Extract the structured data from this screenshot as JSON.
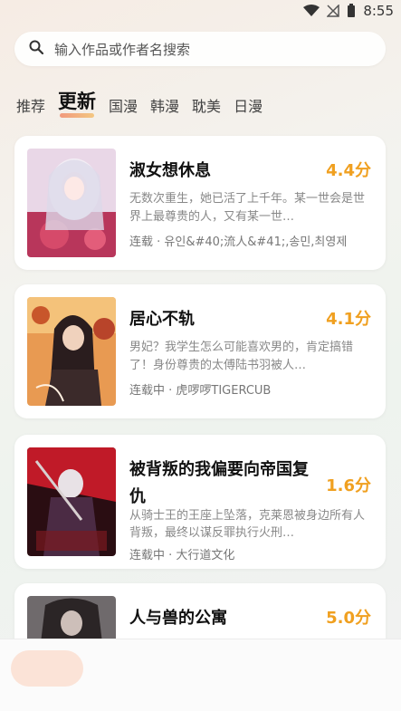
{
  "status": {
    "time": "8:55"
  },
  "search": {
    "placeholder": "输入作品或作者名搜索"
  },
  "tabs": [
    "推荐",
    "更新",
    "国漫",
    "韩漫",
    "耽美",
    "日漫"
  ],
  "active_tab": "更新",
  "comics": [
    {
      "title": "淑女想休息",
      "score": "4.4分",
      "desc": "无数次重生，她已活了上千年。某一世会是世界上最尊贵的人，又有某一世…",
      "meta": "连载 · 유인&#40;流人&#41;,송민,최영제"
    },
    {
      "title": "居心不轨",
      "score": "4.1分",
      "desc": "男妃？我学生怎么可能喜欢男的，肯定搞错了！身份尊贵的太傅陆书羽被人…",
      "meta": "连载中 · 虎啰啰TIGERCUB"
    },
    {
      "title": "被背叛的我偏要向帝国复仇",
      "score": "1.6分",
      "desc": "从骑士王的王座上坠落，克莱恩被身边所有人背叛，最终以谋反罪执行火刑…",
      "meta": "连载中 · 大行道文化"
    },
    {
      "title": "人与兽的公寓",
      "score": "5.0分",
      "desc": "",
      "meta": ""
    }
  ],
  "colors": {
    "score": "#f0a020",
    "accent": "#f08a6a"
  }
}
